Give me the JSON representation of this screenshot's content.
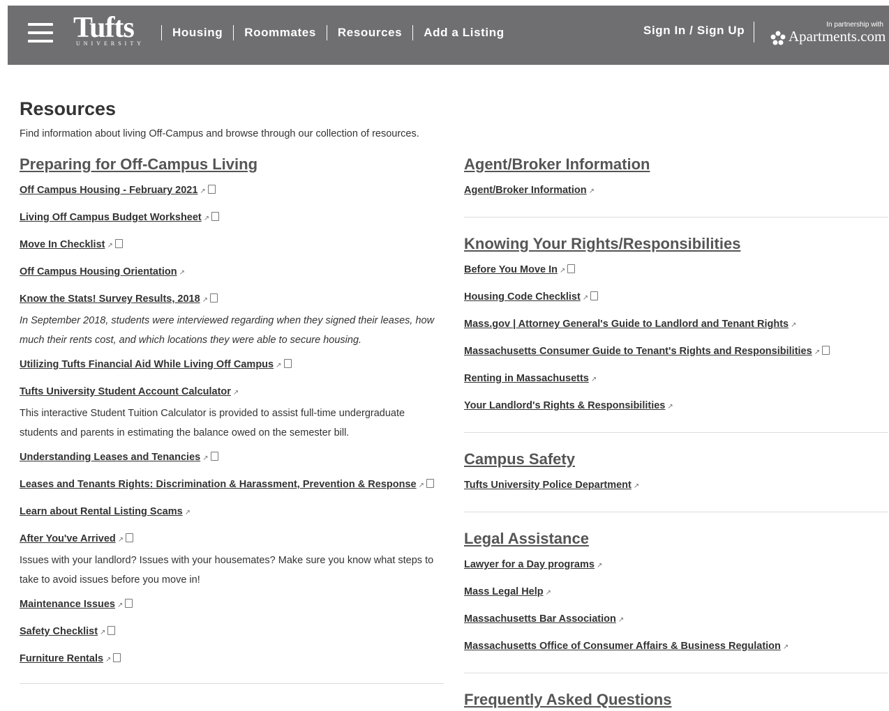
{
  "header": {
    "logo": {
      "word": "Tufts",
      "sub": "UNIVERSITY"
    },
    "nav": [
      "Housing",
      "Roommates",
      "Resources",
      "Add a Listing"
    ],
    "signin": "Sign In / Sign Up",
    "partner": {
      "small": "In partnership with",
      "brand": "Apartments.com"
    }
  },
  "page": {
    "title": "Resources",
    "intro": "Find information about living Off-Campus and browse through our collection of resources."
  },
  "left": {
    "title": "Preparing for Off-Campus Living",
    "items": [
      {
        "label": "Off Campus Housing - February 2021",
        "ext": true,
        "pdf": true
      },
      {
        "label": "Living Off Campus Budget Worksheet",
        "ext": true,
        "pdf": true
      },
      {
        "label": "Move In Checklist",
        "ext": true,
        "pdf": true
      },
      {
        "label": "Off Campus Housing Orientation",
        "ext": true,
        "pdf": false
      },
      {
        "label": "Know the Stats! Survey Results, 2018",
        "ext": true,
        "pdf": true,
        "desc": "In September 2018, students were interviewed regarding when they signed their leases, how much their rents cost, and which locations they were able to secure housing.",
        "italic": true
      },
      {
        "label": "Utilizing Tufts Financial Aid While Living Off Campus",
        "ext": true,
        "pdf": true
      },
      {
        "label": "Tufts University Student Account Calculator",
        "ext": true,
        "pdf": false,
        "desc": "This interactive Student Tuition Calculator is provided to assist full-time undergraduate students and parents in estimating the balance owed on the semester bill.",
        "italic": false
      },
      {
        "label": "Understanding Leases and Tenancies",
        "ext": true,
        "pdf": true
      },
      {
        "label": "Leases and Tenants Rights: Discrimination & Harassment, Prevention & Response",
        "ext": true,
        "pdf": true
      },
      {
        "label": "Learn about Rental Listing Scams",
        "ext": true,
        "pdf": false
      },
      {
        "label": "After You've Arrived",
        "ext": true,
        "pdf": true,
        "desc": "Issues with your landlord? Issues with your housemates? Make sure you know what steps to take to avoid issues before you move in!",
        "italic": false
      },
      {
        "label": "Maintenance Issues",
        "ext": true,
        "pdf": true
      },
      {
        "label": "Safety Checklist",
        "ext": true,
        "pdf": true
      },
      {
        "label": "Furniture Rentals",
        "ext": true,
        "pdf": true
      }
    ]
  },
  "right": [
    {
      "title": "Agent/Broker Information",
      "items": [
        {
          "label": "Agent/Broker Information",
          "ext": true,
          "pdf": false
        }
      ]
    },
    {
      "title": "Knowing Your Rights/Responsibilities",
      "items": [
        {
          "label": "Before You Move In",
          "ext": true,
          "pdf": true
        },
        {
          "label": "Housing Code Checklist",
          "ext": true,
          "pdf": true
        },
        {
          "label": "Mass.gov | Attorney General's Guide to Landlord and Tenant Rights",
          "ext": true,
          "pdf": false
        },
        {
          "label": "Massachusetts Consumer Guide to Tenant's Rights and Responsibilities",
          "ext": true,
          "pdf": true
        },
        {
          "label": "Renting in Massachusetts",
          "ext": true,
          "pdf": false
        },
        {
          "label": "Your Landlord's Rights & Responsibilities",
          "ext": true,
          "pdf": false
        }
      ]
    },
    {
      "title": "Campus Safety",
      "items": [
        {
          "label": "Tufts University Police Department",
          "ext": true,
          "pdf": false
        }
      ]
    },
    {
      "title": "Legal Assistance",
      "items": [
        {
          "label": "Lawyer for a Day programs",
          "ext": true,
          "pdf": false
        },
        {
          "label": "Mass Legal Help",
          "ext": true,
          "pdf": false
        },
        {
          "label": "Massachusetts Bar Association",
          "ext": true,
          "pdf": false
        },
        {
          "label": "Massachusetts Office of Consumer Affairs & Business Regulation",
          "ext": true,
          "pdf": false
        }
      ]
    },
    {
      "title": "Frequently Asked Questions",
      "items": []
    }
  ]
}
